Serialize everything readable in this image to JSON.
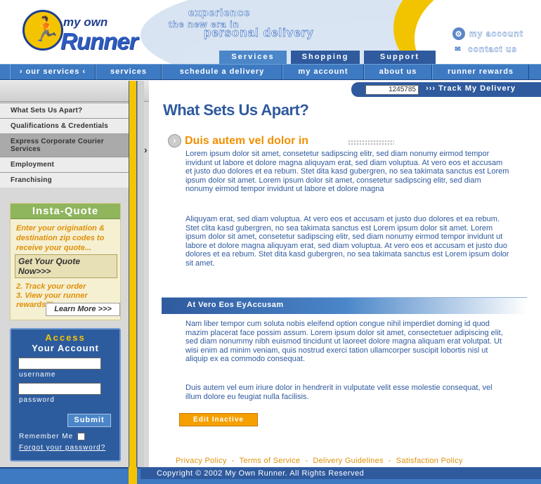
{
  "header": {
    "logo_top": "my own",
    "logo_name": "Runner",
    "tagline_1": "experience",
    "tagline_2": "the new era in",
    "tagline_3": "personal delivery",
    "links": [
      {
        "label": "my account",
        "icon": "gear-icon"
      },
      {
        "label": "contact us",
        "icon": "envelope-icon"
      }
    ],
    "tabs": [
      "Services",
      "Shopping",
      "Support"
    ]
  },
  "navbar": {
    "items": [
      "› our services ‹",
      "services",
      "schedule a delivery",
      "my account",
      "about us",
      "runner rewards"
    ]
  },
  "tracker": {
    "number": "1245785",
    "label": "››› Track My Delivery"
  },
  "sidebar": {
    "menu": [
      "What Sets Us Apart?",
      "Qualifications & Credentials",
      "Express Corporate Courier Services",
      "Employment",
      "Franchising"
    ],
    "arrow": "›",
    "insta_quote": {
      "title": "Insta-Quote",
      "text": "Enter your origination & destination zip codes to receive your quote...",
      "button": "Get Your Quote Now>>>",
      "list": [
        "2. Track your order",
        "3. View your runner rewards™"
      ],
      "learn_more": "Learn More >>>"
    },
    "access": {
      "title_1": "Access",
      "title_2": "Your Account",
      "username_label": "username",
      "password_label": "password",
      "submit": "Submit",
      "remember": "Remember Me",
      "forgot": "Forgot your password?"
    }
  },
  "main": {
    "title": "What Sets Us Apart?",
    "section_title": "Duis autem vel dolor in",
    "para1": "Lorem ipsum dolor sit amet, consetetur sadipscing elitr, sed diam nonumy eirmod tempor invidunt ut labore et dolore magna aliquyam erat, sed diam voluptua. At vero eos et accusam et justo duo dolores et ea rebum. Stet dita kasd gubergren, no sea takimata sanctus est Lorem ipsum dolor sit amet. Lorem ipsum dolor sit amet, consetetur sadipscing elitr, sed diam nonumy eirmod tempor invidunt ut labore et dolore magna",
    "para2": "Aliquyam erat, sed diam voluptua. At vero eos et accusam et justo duo dolores et ea rebum. Stet clita kasd gubergren, no sea takimata sanctus est Lorem ipsum dolor sit amet. Lorem ipsum dolor sit amet, consetetur sadipscing elitr, sed diam nonumy eirmod tempor invidunt ut labore et dolore magna aliquyam erat, sed diam voluptua. At vero eos et accusam et justo duo dolores et ea rebum. Stet dita kasd gubergren, no sea takimata sanctus est Lorem ipsum dolor sit amet.",
    "band_title": "At Vero Eos EyAccusam",
    "para3": "Nam liber tempor cum soluta nobis eleifend option congue nihil imperdiet doming id quod mazim placerat face possim assum. Lorem ipsum dolor sit amet, consectetuer adipiscing elit, sed diam nonummy nibh euismod tincidunt ut laoreet dolore magna aliquam erat volutpat. Ut wisi enim ad minim veniam, quis nostrud exerci tation ullamcorper suscipit lobortis nisl ut aliquip ex ea commodo consequat.",
    "para4": "Duis autem vel eum iriure dolor in hendrerit in vulputate velit esse molestie consequat, vel illum dolore eu feugiat nulla facilisis.",
    "edit_button": "Edit Inactive"
  },
  "footer": {
    "links": [
      "Privacy Policy",
      "Terms of Service",
      "Delivery Guidelines",
      "Satisfaction Policy"
    ],
    "separator": "-",
    "copyright": "Copyright © 2002 My Own Runner. All Rights Reserved"
  },
  "colors": {
    "brand_blue": "#2f5a9e",
    "nav_blue": "#3d7ac2",
    "accent_yellow": "#f5c400",
    "accent_orange": "#f09000"
  }
}
